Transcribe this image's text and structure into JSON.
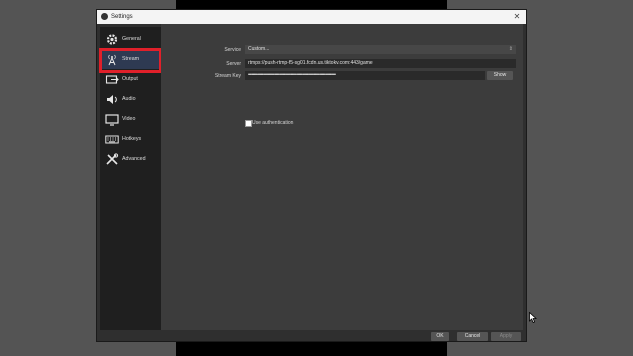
{
  "window": {
    "title": "Settings"
  },
  "sidebar": {
    "items": [
      {
        "label": "General",
        "icon": "gear-icon"
      },
      {
        "label": "Stream",
        "icon": "broadcast-icon"
      },
      {
        "label": "Output",
        "icon": "output-icon"
      },
      {
        "label": "Audio",
        "icon": "speaker-icon"
      },
      {
        "label": "Video",
        "icon": "monitor-icon"
      },
      {
        "label": "Hotkeys",
        "icon": "keyboard-icon"
      },
      {
        "label": "Advanced",
        "icon": "tools-icon"
      }
    ],
    "selected": "Stream"
  },
  "stream": {
    "service_label": "Service",
    "service_value": "Custom...",
    "server_label": "Server",
    "server_value": "rtmps://push-rtmp-f5-sg01.fcdn.us.tiktokv.com:443/game",
    "key_label": "Stream Key",
    "key_value": "••••••••••••••••••••••••••••••••••••••••••••••••••••••••••••••••••••••••••••",
    "show_label": "Show",
    "auth_label": "Use authentication"
  },
  "footer": {
    "ok": "OK",
    "cancel": "Cancel",
    "apply": "Apply"
  },
  "colors": {
    "highlight": "#e0202a",
    "background": "#545454"
  }
}
